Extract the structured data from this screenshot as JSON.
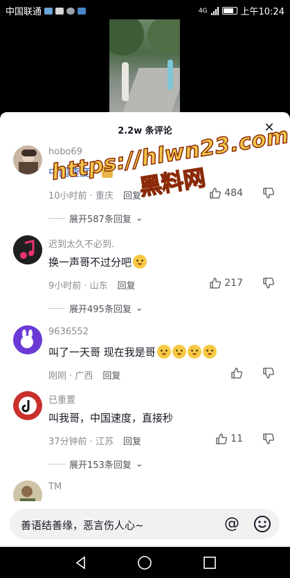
{
  "status_bar": {
    "carrier": "中国联通",
    "time": "上午10:24",
    "network": "4G"
  },
  "comments_header": {
    "title": "2.2w 条评论"
  },
  "comments": [
    {
      "username": "hobo69",
      "text": "中国速度",
      "time_location": "10小时前 · 重庆",
      "reply_label": "回复",
      "likes": "484",
      "expand_label": "展开587条回复"
    },
    {
      "username": "迟到太久不必到.",
      "text": "换一声哥不过分吧",
      "time_location": "9小时前 · 山东",
      "reply_label": "回复",
      "likes": "217",
      "expand_label": "展开495条回复"
    },
    {
      "username": "9636552",
      "text": "叫了一天哥  现在我是哥",
      "time_location": "刚刚 · 广西",
      "reply_label": "回复",
      "likes": "",
      "expand_label": ""
    },
    {
      "username": "已重置",
      "text": "叫我哥，中国速度，直接秒",
      "time_location": "37分钟前 · 江苏",
      "reply_label": "回复",
      "likes": "11",
      "expand_label": "展开153条回复"
    },
    {
      "username": "TM",
      "text": "",
      "time_location": "",
      "reply_label": "",
      "likes": "",
      "expand_label": ""
    }
  ],
  "watermark": {
    "line1": "https://hlwn23.com",
    "line2": "黑料网"
  },
  "input": {
    "placeholder": "善语结善缘，恶言伤人心~"
  },
  "colors": {
    "link_blue": "#2f5ea8",
    "watermark_fill": "#f3c84a",
    "watermark_stroke": "#8a2a08"
  }
}
